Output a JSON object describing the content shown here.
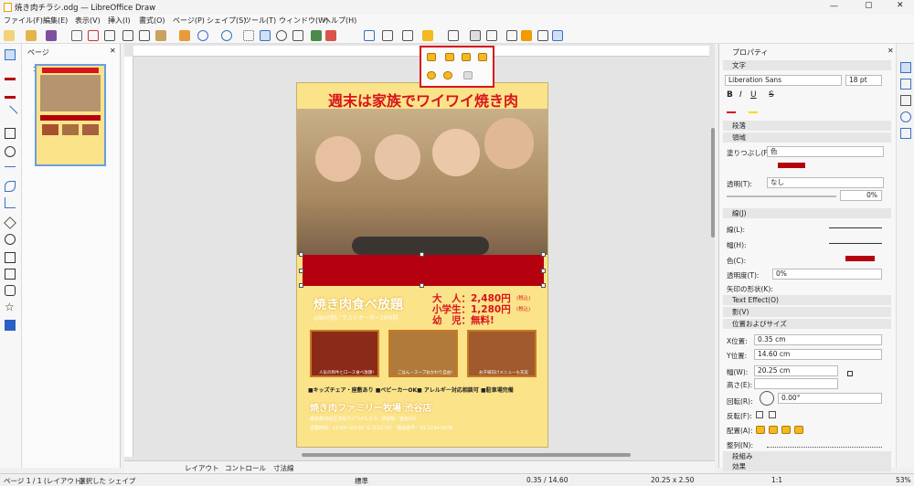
{
  "window": {
    "title": "焼き肉チラシ.odg — LibreOffice Draw",
    "controls": [
      "—",
      "▢",
      "✕"
    ]
  },
  "menu": [
    "ファイル(F)",
    "編集(E)",
    "表示(V)",
    "挿入(I)",
    "書式(O)",
    "ページ(P)",
    "シェイプ(S)",
    "ツール(T)",
    "ウィンドウ(W)",
    "ヘルプ(H)"
  ],
  "pages_panel": {
    "title": "ページ",
    "thumb_number": "1"
  },
  "poster": {
    "headline": "週末は家族でワイワイ焼き肉",
    "plan_title": "焼き肉食べ放題",
    "plan_sub": "◎90分制／ラストオーダー20分前",
    "price_adult": "大　人：2,480円",
    "price_child": "小学生：1,280円",
    "price_infant": "幼　児：無料!",
    "tax1": "(税込)",
    "tax2": "(税込)",
    "food_caption1": "人気の和牛とロース食べ放題!",
    "food_caption2": "ごはん・スープおかわり自由!",
    "food_caption3": "お子様向けメニューも充実",
    "features": "■キッズチェア・座敷あり ■ベビーカーOK■ アレルギー対応相談可 ■駐車場完備",
    "shop_name": "焼き肉ファミリー牧場 渋谷店",
    "address": "東京都渋谷区渋谷ワイワイ1-2-3　渋谷駅／徒歩5分",
    "hours": "営業時間：11:00〜23:00（L.O.22:30）　電話番号：03-1234-5678"
  },
  "sidebar": {
    "title": "プロパティ",
    "sections": {
      "text": "文字",
      "paragraph": "段落",
      "area": "領域",
      "line": "線(J)",
      "text_effect": "Text Effect(O)",
      "shadow": "影(V)",
      "position_size": "位置およびサイズ",
      "columns": "段組み",
      "effects": "効果"
    },
    "font_name": "Liberation Sans",
    "font_size": "18 pt",
    "fill_label": "塗りつぶし(F):",
    "fill_value": "色",
    "transparency_label": "透明(T):",
    "transparency_value": "なし",
    "transparency_pct": "0%",
    "line_label": "線(L):",
    "width_label": "幅(H):",
    "color_label": "色(C):",
    "line_transparency_label": "透明度(T):",
    "line_transparency_value": "0%",
    "arrow_label": "矢印の形状(K):",
    "x_label": "X位置:",
    "x_value": "0.35 cm",
    "y_label": "Y位置:",
    "y_value": "14.60 cm",
    "w_label": "幅(W):",
    "w_value": "20.25 cm",
    "h_label": "高さ(E):",
    "rotation_label": "回転(R):",
    "rotation_value": "0.00°",
    "flip_label": "反転(F):",
    "arrange_label": "配置(A):",
    "align_label": "整列(N):"
  },
  "tabs": [
    "レイアウト",
    "コントロール",
    "寸法線"
  ],
  "status": {
    "page": "ページ 1 / 1 (レイアウト)",
    "selection": "選択した シェイプ",
    "style": "標準",
    "position": "0.35 / 14.60",
    "size": "20.25 x 2.50",
    "ratio": "1:1",
    "zoom": "53%"
  },
  "colors": {
    "accent_red": "#b5000f",
    "poster_yellow": "#fbe38a",
    "highlight_red": "#d8141c"
  }
}
